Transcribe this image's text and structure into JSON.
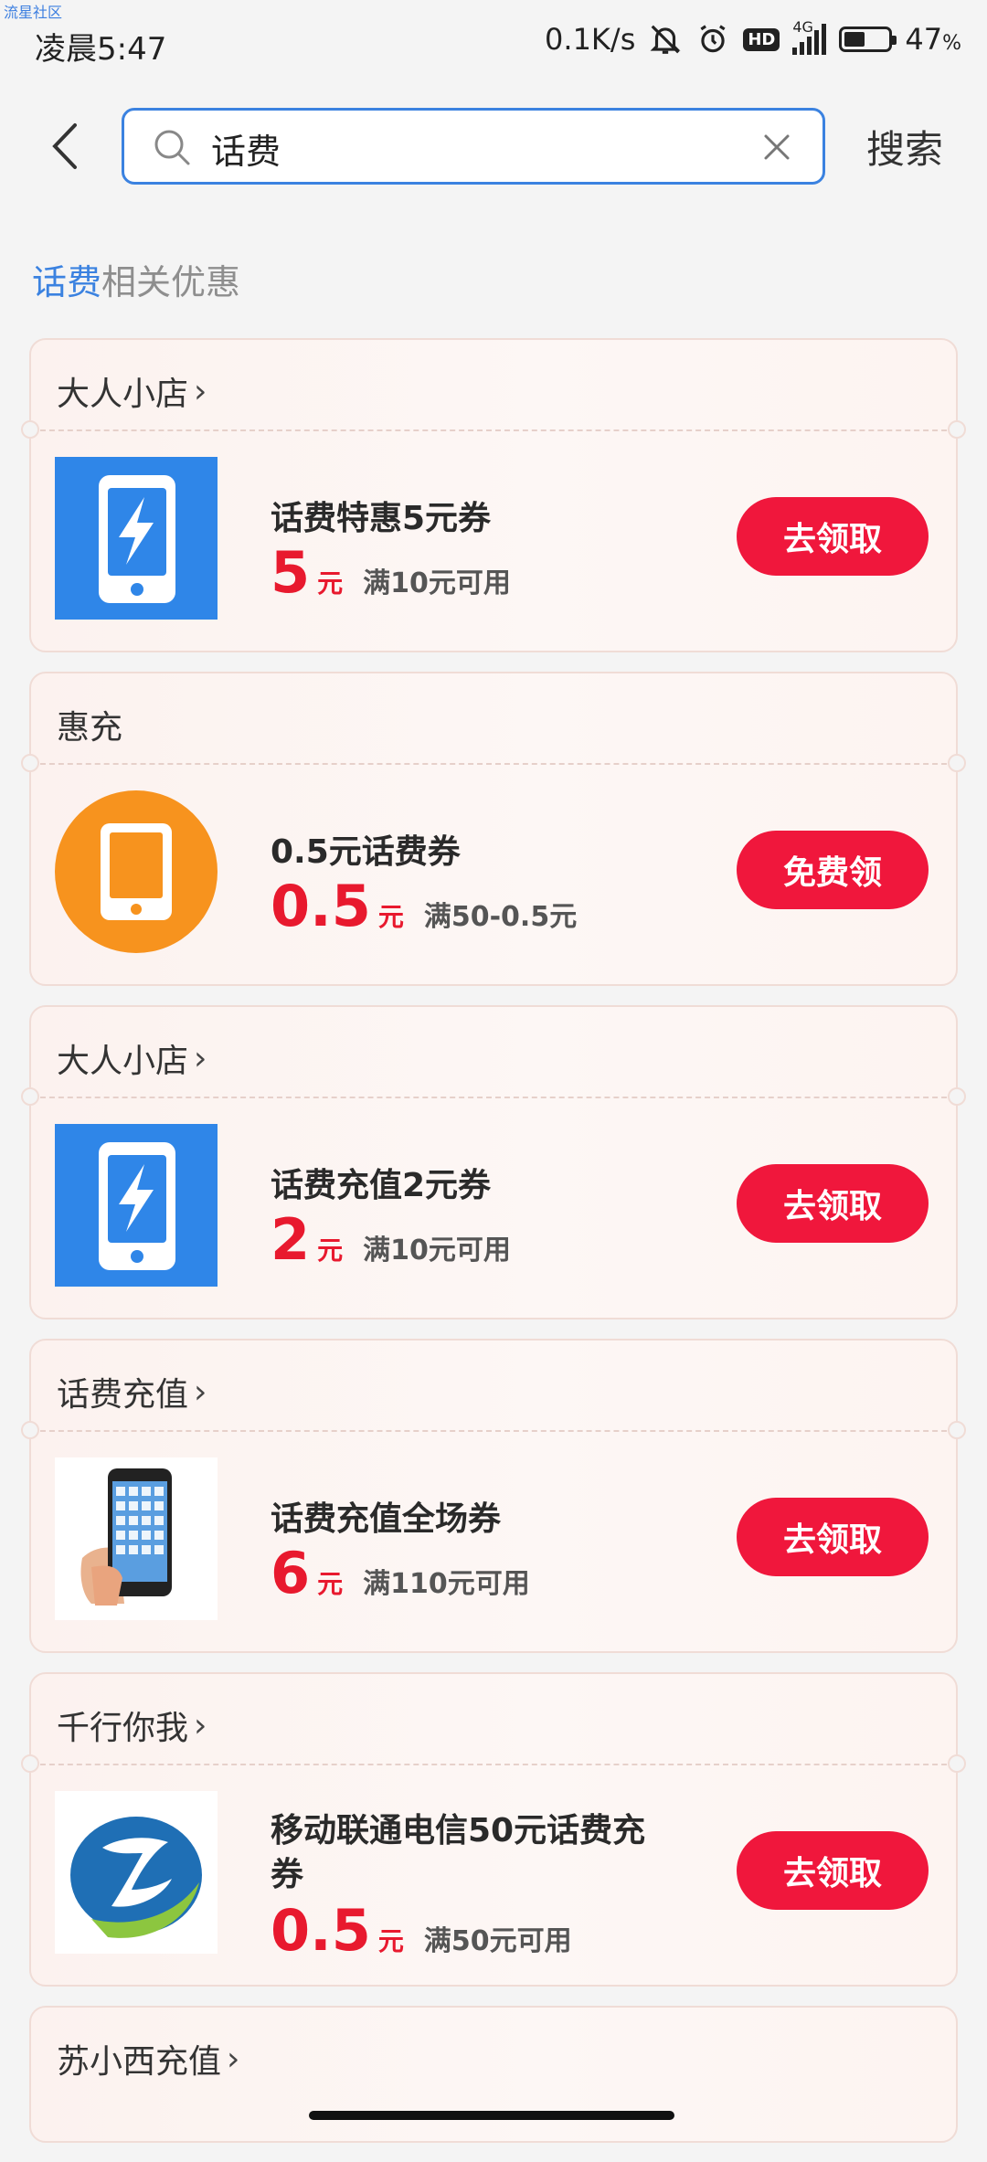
{
  "watermark": "流星社区",
  "status_bar": {
    "time": "凌晨5:47",
    "net_speed": "0.1K/s",
    "hd": "HD",
    "network": "4G",
    "battery_pct": "47",
    "battery_unit": "%",
    "battery_level": 0.47
  },
  "search": {
    "query": "话费",
    "search_button": "搜索"
  },
  "section": {
    "keyword": "话费",
    "suffix": "相关优惠"
  },
  "coupons": [
    {
      "store": "大人小店",
      "has_arrow": true,
      "title": "话费特惠5元券",
      "amount": "5",
      "unit": "元",
      "condition": "满10元可用",
      "cta": "去领取",
      "icon": "blue-phone-lightning-icon"
    },
    {
      "store": "惠充",
      "has_arrow": false,
      "title": "0.5元话费券",
      "amount": "0.5",
      "unit": "元",
      "condition": "满50-0.5元",
      "cta": "免费领",
      "icon": "orange-circle-phone-icon"
    },
    {
      "store": "大人小店",
      "has_arrow": true,
      "title": "话费充值2元券",
      "amount": "2",
      "unit": "元",
      "condition": "满10元可用",
      "cta": "去领取",
      "icon": "blue-phone-lightning-icon"
    },
    {
      "store": "话费充值",
      "has_arrow": true,
      "title": "话费充值全场券",
      "amount": "6",
      "unit": "元",
      "condition": "满110元可用",
      "cta": "去领取",
      "icon": "hand-holding-phone-icon"
    },
    {
      "store": "千行你我",
      "has_arrow": true,
      "title": "移动联通电信50元话费充券",
      "amount": "0.5",
      "unit": "元",
      "condition": "满50元可用",
      "cta": "去领取",
      "icon": "blue-green-swoosh-logo-icon"
    },
    {
      "store": "苏小西充值",
      "has_arrow": true
    }
  ],
  "colors": {
    "accent_blue": "#3b82e0",
    "price_red": "#e8192e",
    "cta_red": "#f0173c"
  }
}
